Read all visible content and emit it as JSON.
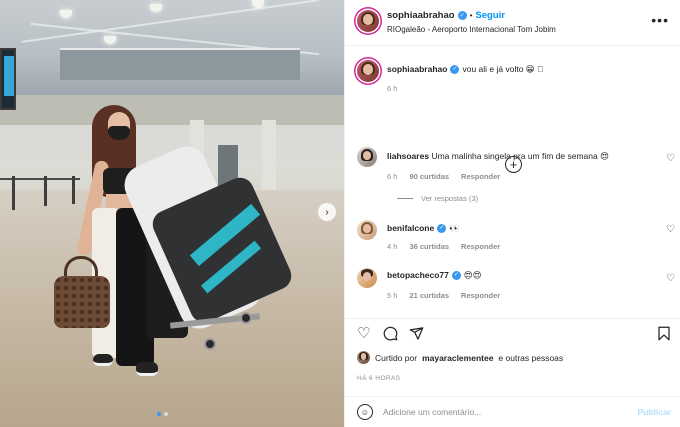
{
  "post": {
    "username": "sophiaabrahao",
    "verified": true,
    "follow_label": "Seguir",
    "separator": "•",
    "location": "RIOgaleão - Aeroporto Internacional Tom Jobim",
    "more_icon": "more-horizontal-icon",
    "caption": "vou ali e já volto 😁 🏻",
    "caption_time": "6 h",
    "carousel": {
      "total_slides": 2,
      "active_slide": 1
    }
  },
  "comments": [
    {
      "username": "liahsoares",
      "text": "Uma malinha singela pra um fim de semana 😍",
      "time": "6 h",
      "likes": "90 curtidas",
      "reply_label": "Responder"
    },
    {
      "username": "benifalcone",
      "verified": true,
      "text": "👀",
      "time": "4 h",
      "likes": "36 curtidas",
      "reply_label": "Responder"
    },
    {
      "username": "betopacheco77",
      "verified": true,
      "text": "😍😍",
      "time": "5 h",
      "likes": "21 curtidas",
      "reply_label": "Responder"
    }
  ],
  "view_replies_label": "Ver respostas (3)",
  "liked_by": {
    "prefix": "Curtido por",
    "user": "mayaraclementee",
    "suffix": "e outras pessoas"
  },
  "posted_ago": "HÁ 6 HORAS",
  "add_comment": {
    "placeholder": "Adicione um comentário...",
    "publish_label": "Publicar"
  },
  "icons": {
    "like": "heart-icon",
    "comment": "comment-bubble-icon",
    "share": "paper-plane-icon",
    "save": "bookmark-icon",
    "emoji": "smiley-icon",
    "load_more": "plus-circle-icon",
    "next": "chevron-right-icon"
  },
  "colors": {
    "link_blue": "#0095f6",
    "verified_blue": "#3897f0",
    "muted_text": "#8e8e8e",
    "publish_disabled": "#b2dffc"
  }
}
